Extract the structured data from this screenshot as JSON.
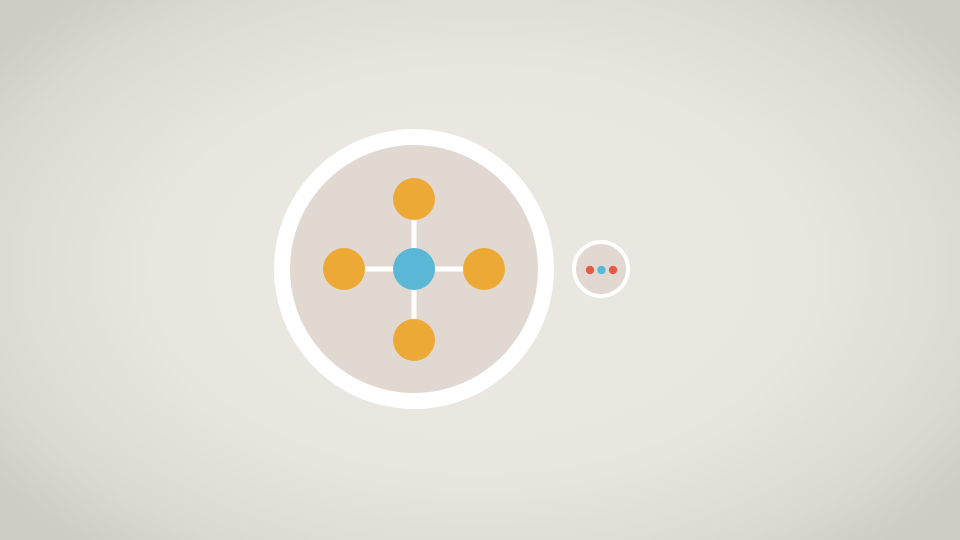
{
  "colors": {
    "ring": "#ffffff",
    "disc_fill": "#e1d9d1",
    "hub": "#5ab7d6",
    "satellite": "#eda935",
    "connector": "#ffffff",
    "dot_outer": "#e35a47",
    "dot_middle": "#5ab7d6"
  },
  "icons": {
    "hub_network": "network-hub-icon",
    "more": "ellipsis-icon"
  }
}
